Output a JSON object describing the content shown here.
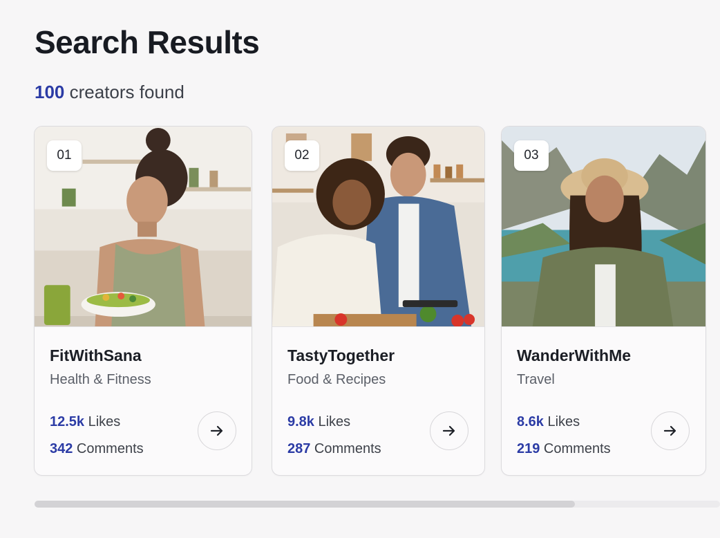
{
  "page": {
    "title": "Search Results",
    "result_count": "100",
    "result_suffix": " creators found"
  },
  "creators": [
    {
      "rank": "01",
      "name": "FitWithSana",
      "category": "Health & Fitness",
      "likes_value": "12.5k",
      "likes_label": " Likes",
      "comments_value": "342",
      "comments_label": " Comments",
      "photo": "woman eating a salad in a kitchen"
    },
    {
      "rank": "02",
      "name": "TastyTogether",
      "category": "Food & Recipes",
      "likes_value": "9.8k",
      "likes_label": " Likes",
      "comments_value": "287",
      "comments_label": " Comments",
      "photo": "couple cooking together in a kitchen"
    },
    {
      "rank": "03",
      "name": "WanderWithMe",
      "category": "Travel",
      "likes_value": "8.6k",
      "likes_label": " Likes",
      "comments_value": "219",
      "comments_label": " Comments",
      "photo": "woman in a sun hat by a mountain lake"
    }
  ],
  "icons": {
    "open_profile": "arrow-right-icon"
  },
  "scroll": {
    "position": 0.79
  },
  "colors": {
    "accent": "#2b3ba5",
    "background": "#f7f6f7",
    "card": "#fbfafb"
  }
}
